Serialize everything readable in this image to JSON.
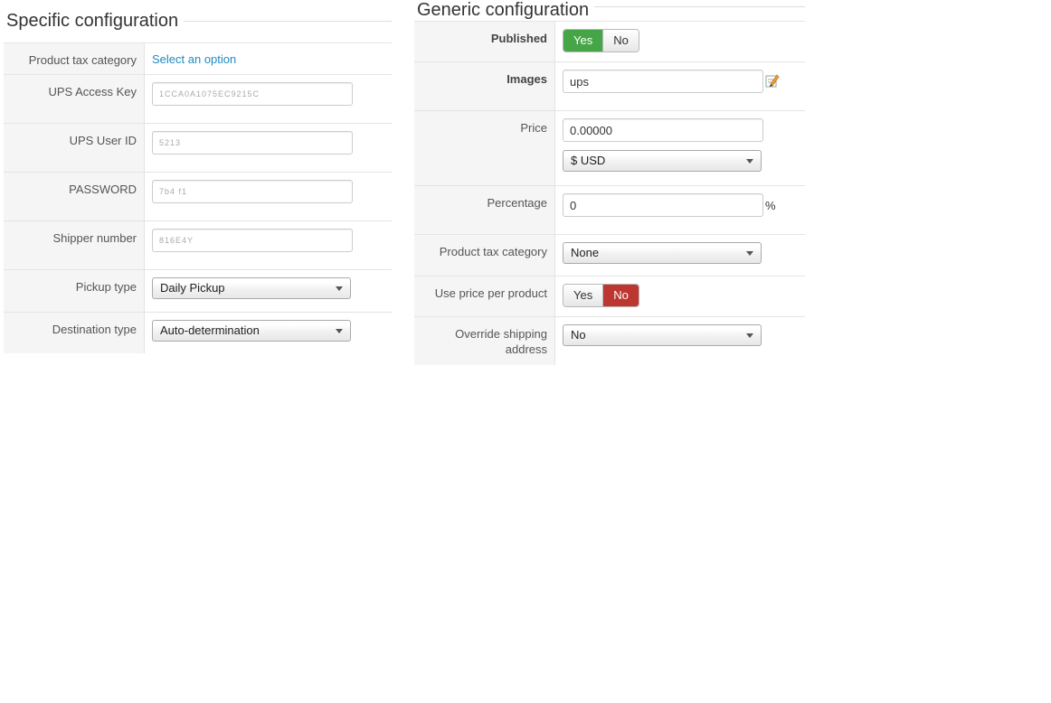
{
  "specific": {
    "title": "Specific configuration",
    "rows": {
      "tax_category": {
        "label": "Product tax category",
        "value": "Select an option"
      },
      "access_key": {
        "label": "UPS Access Key",
        "value": "1CCA0A1075EC9215C"
      },
      "user_id": {
        "label": "UPS User ID",
        "value": "5213"
      },
      "password": {
        "label": "PASSWORD",
        "value": "7b4 f1"
      },
      "shipper_number": {
        "label": "Shipper number",
        "value": "816E4Y"
      },
      "pickup_type": {
        "label": "Pickup type",
        "value": "Daily Pickup"
      },
      "destination_type": {
        "label": "Destination type",
        "value": "Auto-determination"
      }
    }
  },
  "generic": {
    "title": "Generic configuration",
    "rows": {
      "published": {
        "label": "Published",
        "yes": "Yes",
        "no": "No",
        "selected": "Yes"
      },
      "images": {
        "label": "Images",
        "value": "ups"
      },
      "price": {
        "label": "Price",
        "value": "0.00000",
        "currency": "$ USD"
      },
      "percentage": {
        "label": "Percentage",
        "value": "0",
        "unit": "%"
      },
      "tax_category": {
        "label": "Product tax category",
        "value": "None"
      },
      "price_per_product": {
        "label": "Use price per product",
        "yes": "Yes",
        "no": "No",
        "selected": "No"
      },
      "override_address": {
        "label": "Override shipping address",
        "value": "No"
      }
    }
  },
  "colors": {
    "link": "#1e8bc3",
    "toggle_yes_active": "#46a546",
    "toggle_no_active": "#bd362f"
  },
  "icons": {
    "images_edit": "pencil-edit-icon"
  }
}
